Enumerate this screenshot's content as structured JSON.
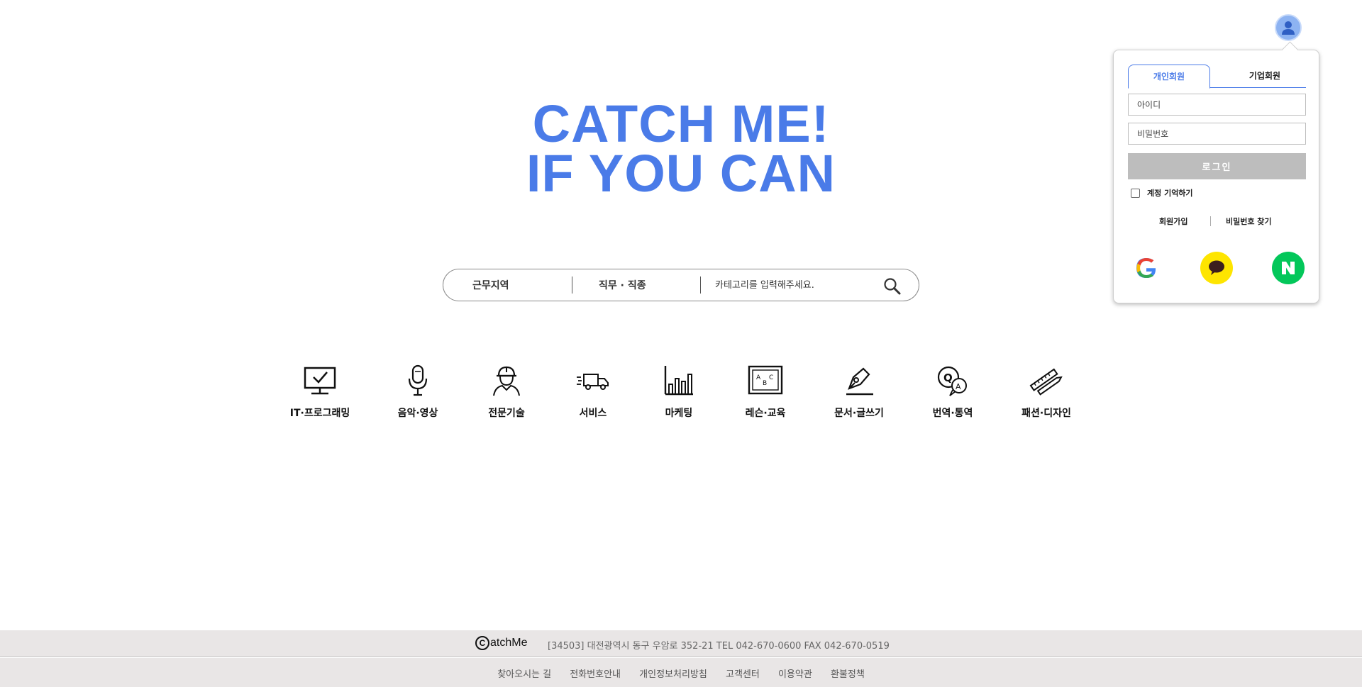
{
  "hero": {
    "line1": "CATCH ME!",
    "line2": "IF YOU CAN",
    "color": "#4a7be8"
  },
  "search": {
    "location_label": "근무지역",
    "job_label": "직무 · 직종",
    "placeholder": "카테고리를 입력해주세요.",
    "button_icon": "search-icon"
  },
  "categories": [
    {
      "label": "IT·프로그래밍",
      "icon": "monitor-check-icon"
    },
    {
      "label": "음악·영상",
      "icon": "microphone-icon"
    },
    {
      "label": "전문기술",
      "icon": "worker-helmet-icon"
    },
    {
      "label": "서비스",
      "icon": "delivery-truck-icon"
    },
    {
      "label": "마케팅",
      "icon": "bar-chart-icon"
    },
    {
      "label": "레슨·교육",
      "icon": "abc-board-icon"
    },
    {
      "label": "문서·글쓰기",
      "icon": "pen-nib-icon"
    },
    {
      "label": "번역·통역",
      "icon": "qa-bubbles-icon"
    },
    {
      "label": "패션·디자인",
      "icon": "ruler-pencil-icon"
    }
  ],
  "login": {
    "tab_personal": "개인회원",
    "tab_business": "기업회원",
    "id_placeholder": "아이디",
    "password_placeholder": "비밀번호",
    "login_button": "로그인",
    "remember_label": "계정 기억하기",
    "signup_link": "회원가입",
    "find_password_link": "비밀번호 찾기",
    "social": [
      "google-icon",
      "kakao-icon",
      "naver-icon"
    ]
  },
  "footer": {
    "brand_mark": "C",
    "brand_text": "atchMe",
    "address": "[34503] 대전광역시 동구 우암로 352-21 TEL 042-670-0600 FAX 042-670-0519",
    "links": [
      "찾아오시는 길",
      "전화번호안내",
      "개인정보처리방침",
      "고객센터",
      "이용약관",
      "환불정책"
    ]
  }
}
